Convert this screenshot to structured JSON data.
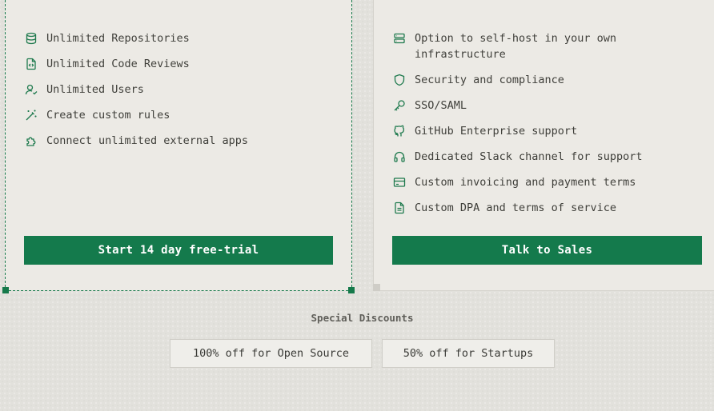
{
  "plans": {
    "left": {
      "features": [
        {
          "icon": "database-icon",
          "label": "Unlimited Repositories"
        },
        {
          "icon": "code-file-icon",
          "label": "Unlimited Code Reviews"
        },
        {
          "icon": "user-check-icon",
          "label": "Unlimited Users"
        },
        {
          "icon": "magic-wand-icon",
          "label": "Create custom rules"
        },
        {
          "icon": "puzzle-icon",
          "label": "Connect unlimited external apps"
        }
      ],
      "cta_label": "Start 14 day free-trial"
    },
    "right": {
      "features": [
        {
          "icon": "server-icon",
          "label": "Option to self-host in your own infrastructure"
        },
        {
          "icon": "shield-icon",
          "label": "Security and compliance"
        },
        {
          "icon": "key-icon",
          "label": "SSO/SAML"
        },
        {
          "icon": "github-icon",
          "label": "GitHub Enterprise support"
        },
        {
          "icon": "headphones-icon",
          "label": "Dedicated Slack channel for support"
        },
        {
          "icon": "credit-card-icon",
          "label": "Custom invoicing and payment terms"
        },
        {
          "icon": "document-icon",
          "label": "Custom DPA and terms of service"
        }
      ],
      "cta_label": "Talk to Sales"
    }
  },
  "discounts": {
    "title": "Special Discounts",
    "open_source": "100% off for Open Source",
    "startups": "50% off for Startups"
  },
  "colors": {
    "accent": "#147a4c",
    "icon": "#1f7a4e",
    "card_bg": "#eceae5",
    "page_bg": "#e2e1dc"
  }
}
